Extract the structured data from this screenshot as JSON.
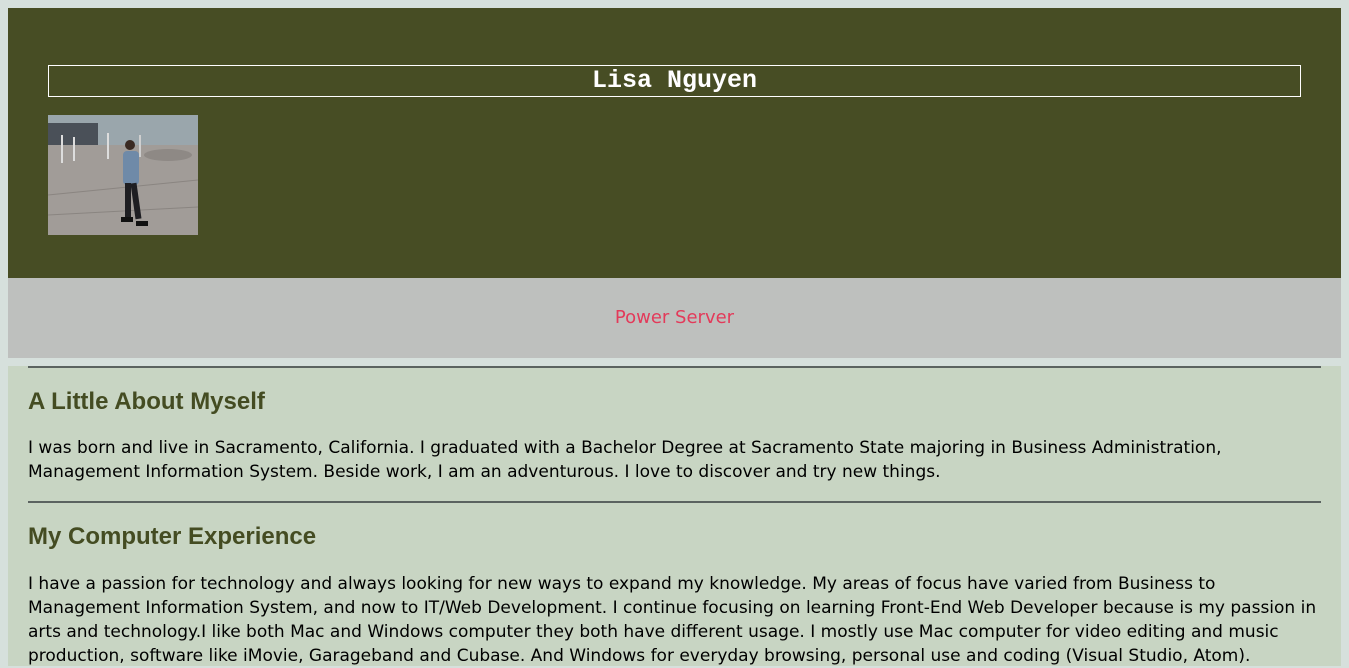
{
  "header": {
    "name": "Lisa Nguyen",
    "photo_alt": "Photo of Lisa Nguyen"
  },
  "nav": {
    "link": "Power Server"
  },
  "sections": [
    {
      "heading": "A Little About Myself",
      "body": "I was born and live in Sacramento, California. I graduated with a Bachelor Degree at Sacramento State majoring in Business Administration, Management Information System. Beside work, I am an adventurous. I love to discover and try new things."
    },
    {
      "heading": "My Computer Experience",
      "body": "I have a passion for technology and always looking for new ways to expand my knowledge. My areas of focus have varied from Business to Management Information System, and now to IT/Web Development. I continue focusing on learning Front-End Web Developer because is my passion in arts and technology.I like both Mac and Windows computer they both have different usage. I mostly use Mac computer for video editing and music production, software like iMovie, Garageband and Cubase. And Windows for everyday browsing, personal use and coding (Visual Studio, Atom)."
    }
  ],
  "colors": {
    "header_bg": "#474d24",
    "nav_bg": "#bec0be",
    "nav_link": "#e33a5a",
    "main_bg": "#c8d5c3",
    "heading": "#444c22"
  }
}
